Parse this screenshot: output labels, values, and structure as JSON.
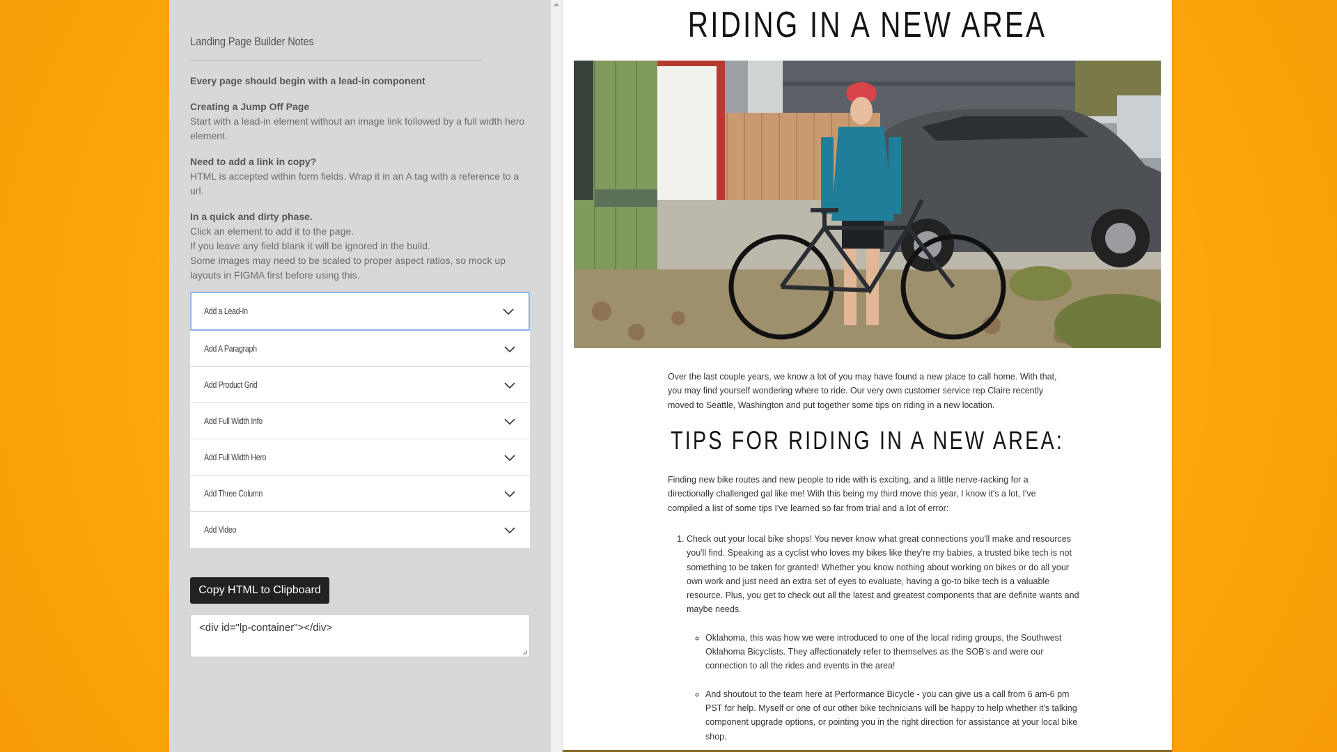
{
  "builder": {
    "title": "Landing Page Builder Notes",
    "notes": [
      {
        "heading": "Every page should begin with a lead-in component",
        "lines": []
      },
      {
        "heading": "Creating a Jump Off Page",
        "lines": [
          "Start with a lead-in element without an image link followed by a full width hero element."
        ]
      },
      {
        "heading": "Need to add a link in copy?",
        "lines": [
          "HTML is accepted within form fields. Wrap it in an A tag with a reference to a url."
        ]
      },
      {
        "heading": "In a quick and dirty phase.",
        "lines": [
          "Click an element to add it to the page.",
          "If you leave any field blank it will be ignored in the build.",
          "Some images may need to be scaled to proper aspect ratios, so mock up layouts in FIGMA first before using this."
        ]
      }
    ],
    "components": [
      {
        "label": "Add a Lead-In",
        "active": true
      },
      {
        "label": "Add A Paragraph",
        "active": false
      },
      {
        "label": "Add Product Grid",
        "active": false
      },
      {
        "label": "Add Full Width Info",
        "active": false
      },
      {
        "label": "Add Full Width Hero",
        "active": false
      },
      {
        "label": "Add Three Column",
        "active": false
      },
      {
        "label": "Add Video",
        "active": false
      }
    ],
    "copy_button": "Copy HTML to Clipboard",
    "html_output": "<div id=\"lp-container\"></div>"
  },
  "preview": {
    "hero_title": "RIDING IN A NEW AREA",
    "intro": "Over the last couple years, we know a lot of you may have found a new place to call home. With that, you may find yourself wondering where to ride. Our very own customer service rep Claire recently moved to Seattle, Washington and put together some tips on riding in a new location.",
    "tips_title": "TIPS FOR RIDING IN A NEW AREA:",
    "tips_intro": "Finding new bike routes and new people to ride with is exciting, and a little nerve-racking for a directionally challenged gal like me! With this being my third move this year, I know it's a lot, I've compiled a list of some tips I've learned so far from trial and a lot of error:",
    "tips": [
      "Check out your local bike shops! You never know what great connections you'll make and resources you'll find. Speaking as a cyclist who loves my bikes like they're my babies, a trusted bike tech is not something to be taken for granted! Whether you know nothing about working on bikes or do all your own work and just need an extra set of eyes to evaluate, having a go-to bike tech is a valuable resource. Plus, you get to check out all the latest and greatest components that are definite wants and maybe needs."
    ],
    "sub_tips": [
      "Oklahoma, this was how we were introduced to one of the local riding groups, the Southwest Oklahoma Bicyclists. They affectionately refer to themselves as the SOB's and were our connection to all the rides and events in the area!",
      "And shoutout to the team here at Performance Bicycle - you can give us a call from 6 am-6 pm PST for help. Myself or one of our other bike technicians will be happy to help whether it's talking component upgrade options, or pointing you in the right direction for assistance at your local bike shop."
    ]
  }
}
